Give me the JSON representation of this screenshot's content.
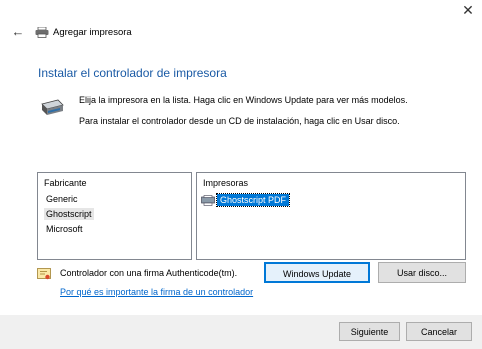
{
  "window": {
    "title": "Agregar impresora",
    "close_glyph": "✕",
    "back_glyph": "←"
  },
  "main": {
    "heading": "Instalar el controlador de impresora",
    "instruction_1": "Elija la impresora en la lista. Haga clic en Windows Update para ver más modelos.",
    "instruction_2": "Para instalar el controlador desde un CD de instalación, haga clic en Usar disco."
  },
  "manufacturers": {
    "header": "Fabricante",
    "items": [
      "Generic",
      "Ghostscript",
      "Microsoft"
    ],
    "selected": "Ghostscript"
  },
  "printers": {
    "header": "Impresoras",
    "items": [
      "Ghostscript PDF"
    ],
    "selected": "Ghostscript PDF"
  },
  "signature": {
    "text": "Controlador con una firma Authenticode(tm).",
    "link": "Por qué es importante la firma de un controlador"
  },
  "buttons": {
    "windows_update": "Windows Update",
    "have_disk": "Usar disco...",
    "next": "Siguiente",
    "cancel": "Cancelar"
  },
  "colors": {
    "heading": "#1a5aa5",
    "selection": "#0078d7",
    "link": "#0066cc",
    "footer": "#f0f0f0"
  }
}
